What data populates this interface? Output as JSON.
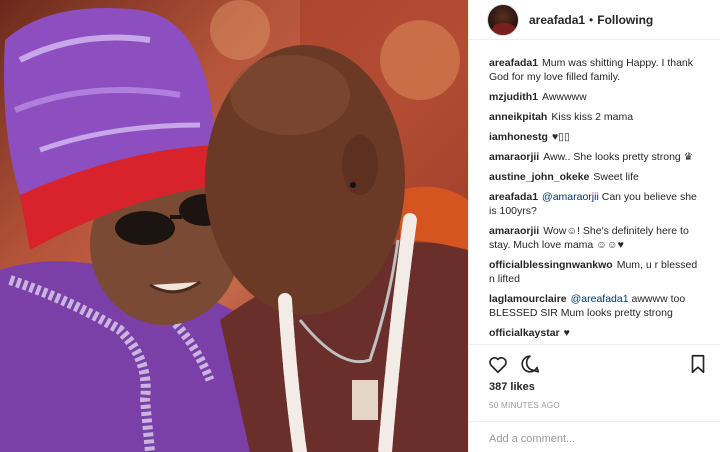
{
  "header": {
    "username": "areafada1",
    "separator": "•",
    "follow_status": "Following"
  },
  "comments": [
    {
      "user": "areafada1",
      "text": "Mum was shitting Happy. I thank God for my love filled family."
    },
    {
      "user": "mzjudith1",
      "text": "Awwwww"
    },
    {
      "user": "anneikpitah",
      "text": "Kiss kiss 2 mama"
    },
    {
      "user": "iamhonestg",
      "text": "♥▯▯"
    },
    {
      "user": "amaraorjii",
      "text": "Aww.. She looks pretty strong ♛"
    },
    {
      "user": "austine_john_okeke",
      "text": "Sweet life"
    },
    {
      "user": "areafada1",
      "mention": "@amaraorjii",
      "text": "Can you believe she is 100yrs?"
    },
    {
      "user": "amaraorjii",
      "text": "Wow☺! She's definitely here to stay. Much love mama ☺☺♥"
    },
    {
      "user": "officialblessingnwankwo",
      "text": "Mum, u r blessed n lifted"
    },
    {
      "user": "laglamourclaire",
      "mention": "@areafada1",
      "text": "awwww too BLESSED SIR Mum looks pretty strong"
    },
    {
      "user": "officialkaystar",
      "text": "♥"
    }
  ],
  "actions": {
    "like_icon": "heart-outline-icon",
    "comment_icon": "speech-bubble-icon",
    "save_icon": "bookmark-icon"
  },
  "likes": "387 likes",
  "timestamp": "50 MINUTES AGO",
  "comment_input": {
    "placeholder": "Add a comment..."
  },
  "colors": {
    "mention": "#003569",
    "muted": "#999999",
    "border": "#efefef",
    "text": "#262626"
  }
}
